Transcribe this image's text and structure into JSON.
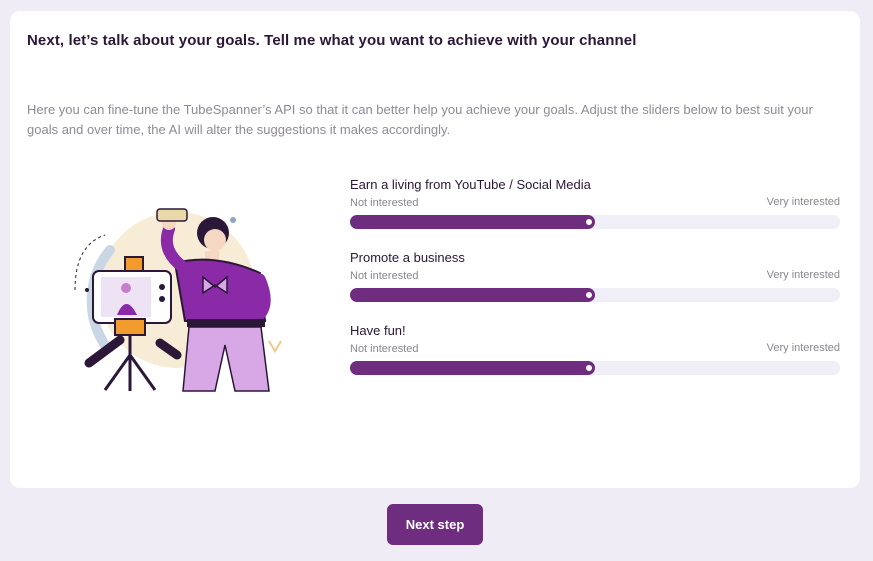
{
  "card": {
    "title": "Next, let’s talk about your goals. Tell me what you want to achieve with your channel",
    "intro": "Here you can fine-tune the TubeSpanner’s API so that it can better help you achieve your goals. Adjust the sliders below to best suit your goals and over time, the AI will alter the suggestions it makes accordingly."
  },
  "illustration": {
    "icon": "content-creator-illustration"
  },
  "sliders": [
    {
      "label": "Earn a living from YouTube / Social Media",
      "min_label": "Not interested",
      "max_label": "Very interested",
      "value": 0.5
    },
    {
      "label": "Promote a business",
      "min_label": "Not interested",
      "max_label": "Very interested",
      "value": 0.5
    },
    {
      "label": "Have fun!",
      "min_label": "Not interested",
      "max_label": "Very interested",
      "value": 0.5
    }
  ],
  "footer": {
    "next_label": "Next step"
  },
  "colors": {
    "accent": "#6e2d7e",
    "background": "#efecf6",
    "track": "#f0eef6"
  }
}
